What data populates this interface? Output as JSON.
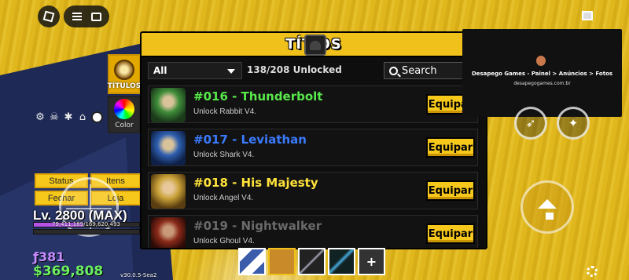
{
  "colors": {
    "accent": "#f0c11b",
    "panel_bg": "#0e0e0e",
    "money": "#6cf060",
    "fragments": "#c68cff"
  },
  "topbar": {
    "roblox_icon": "roblox-logo-icon",
    "menu_icon": "hamburger-icon",
    "chat_icon": "chat-icon"
  },
  "left_tabs": [
    {
      "label": "TÍTULOS",
      "icon": "titles-badge-icon",
      "active": true
    },
    {
      "label": "Color",
      "icon": "color-wheel-icon",
      "active": false
    }
  ],
  "panel": {
    "title": "TÍT   OS",
    "filter": {
      "selected": "All"
    },
    "unlocked_text": "138/208 Unlocked",
    "search_placeholder": "Search",
    "titles": [
      {
        "name": "#016 - Thunderbolt",
        "desc": "Unlock Rabbit V4.",
        "color": "#57e84a",
        "button": "Equipar"
      },
      {
        "name": "#017 - Leviathan",
        "desc": "Unlock Shark V4.",
        "color": "#3b7bff",
        "button": "Equipar"
      },
      {
        "name": "#018 - His Majesty",
        "desc": "Unlock Angel V4.",
        "color": "#ffe23a",
        "button": "Equipar"
      },
      {
        "name": "#019 - Nightwalker",
        "desc": "Unlock Ghoul V4.",
        "color": "#6a6a6a",
        "button": "Equipar"
      }
    ]
  },
  "player": {
    "menu_buttons": [
      "Status",
      "Itens",
      "Fechar",
      "Loja"
    ],
    "level_text": "Lv. 2800 (MAX)",
    "xp_text": "79,411,189/169,620,493",
    "xp_fraction": 0.47,
    "fragments": "ƒ381",
    "money": "$369,808",
    "version": "v30.0.5-Sea2"
  },
  "ad": {
    "title": "Desapego Games - Painel > Anúncios > Fotos",
    "url": "desapegogames.com.br"
  },
  "hotbar": {
    "plus": "+"
  }
}
